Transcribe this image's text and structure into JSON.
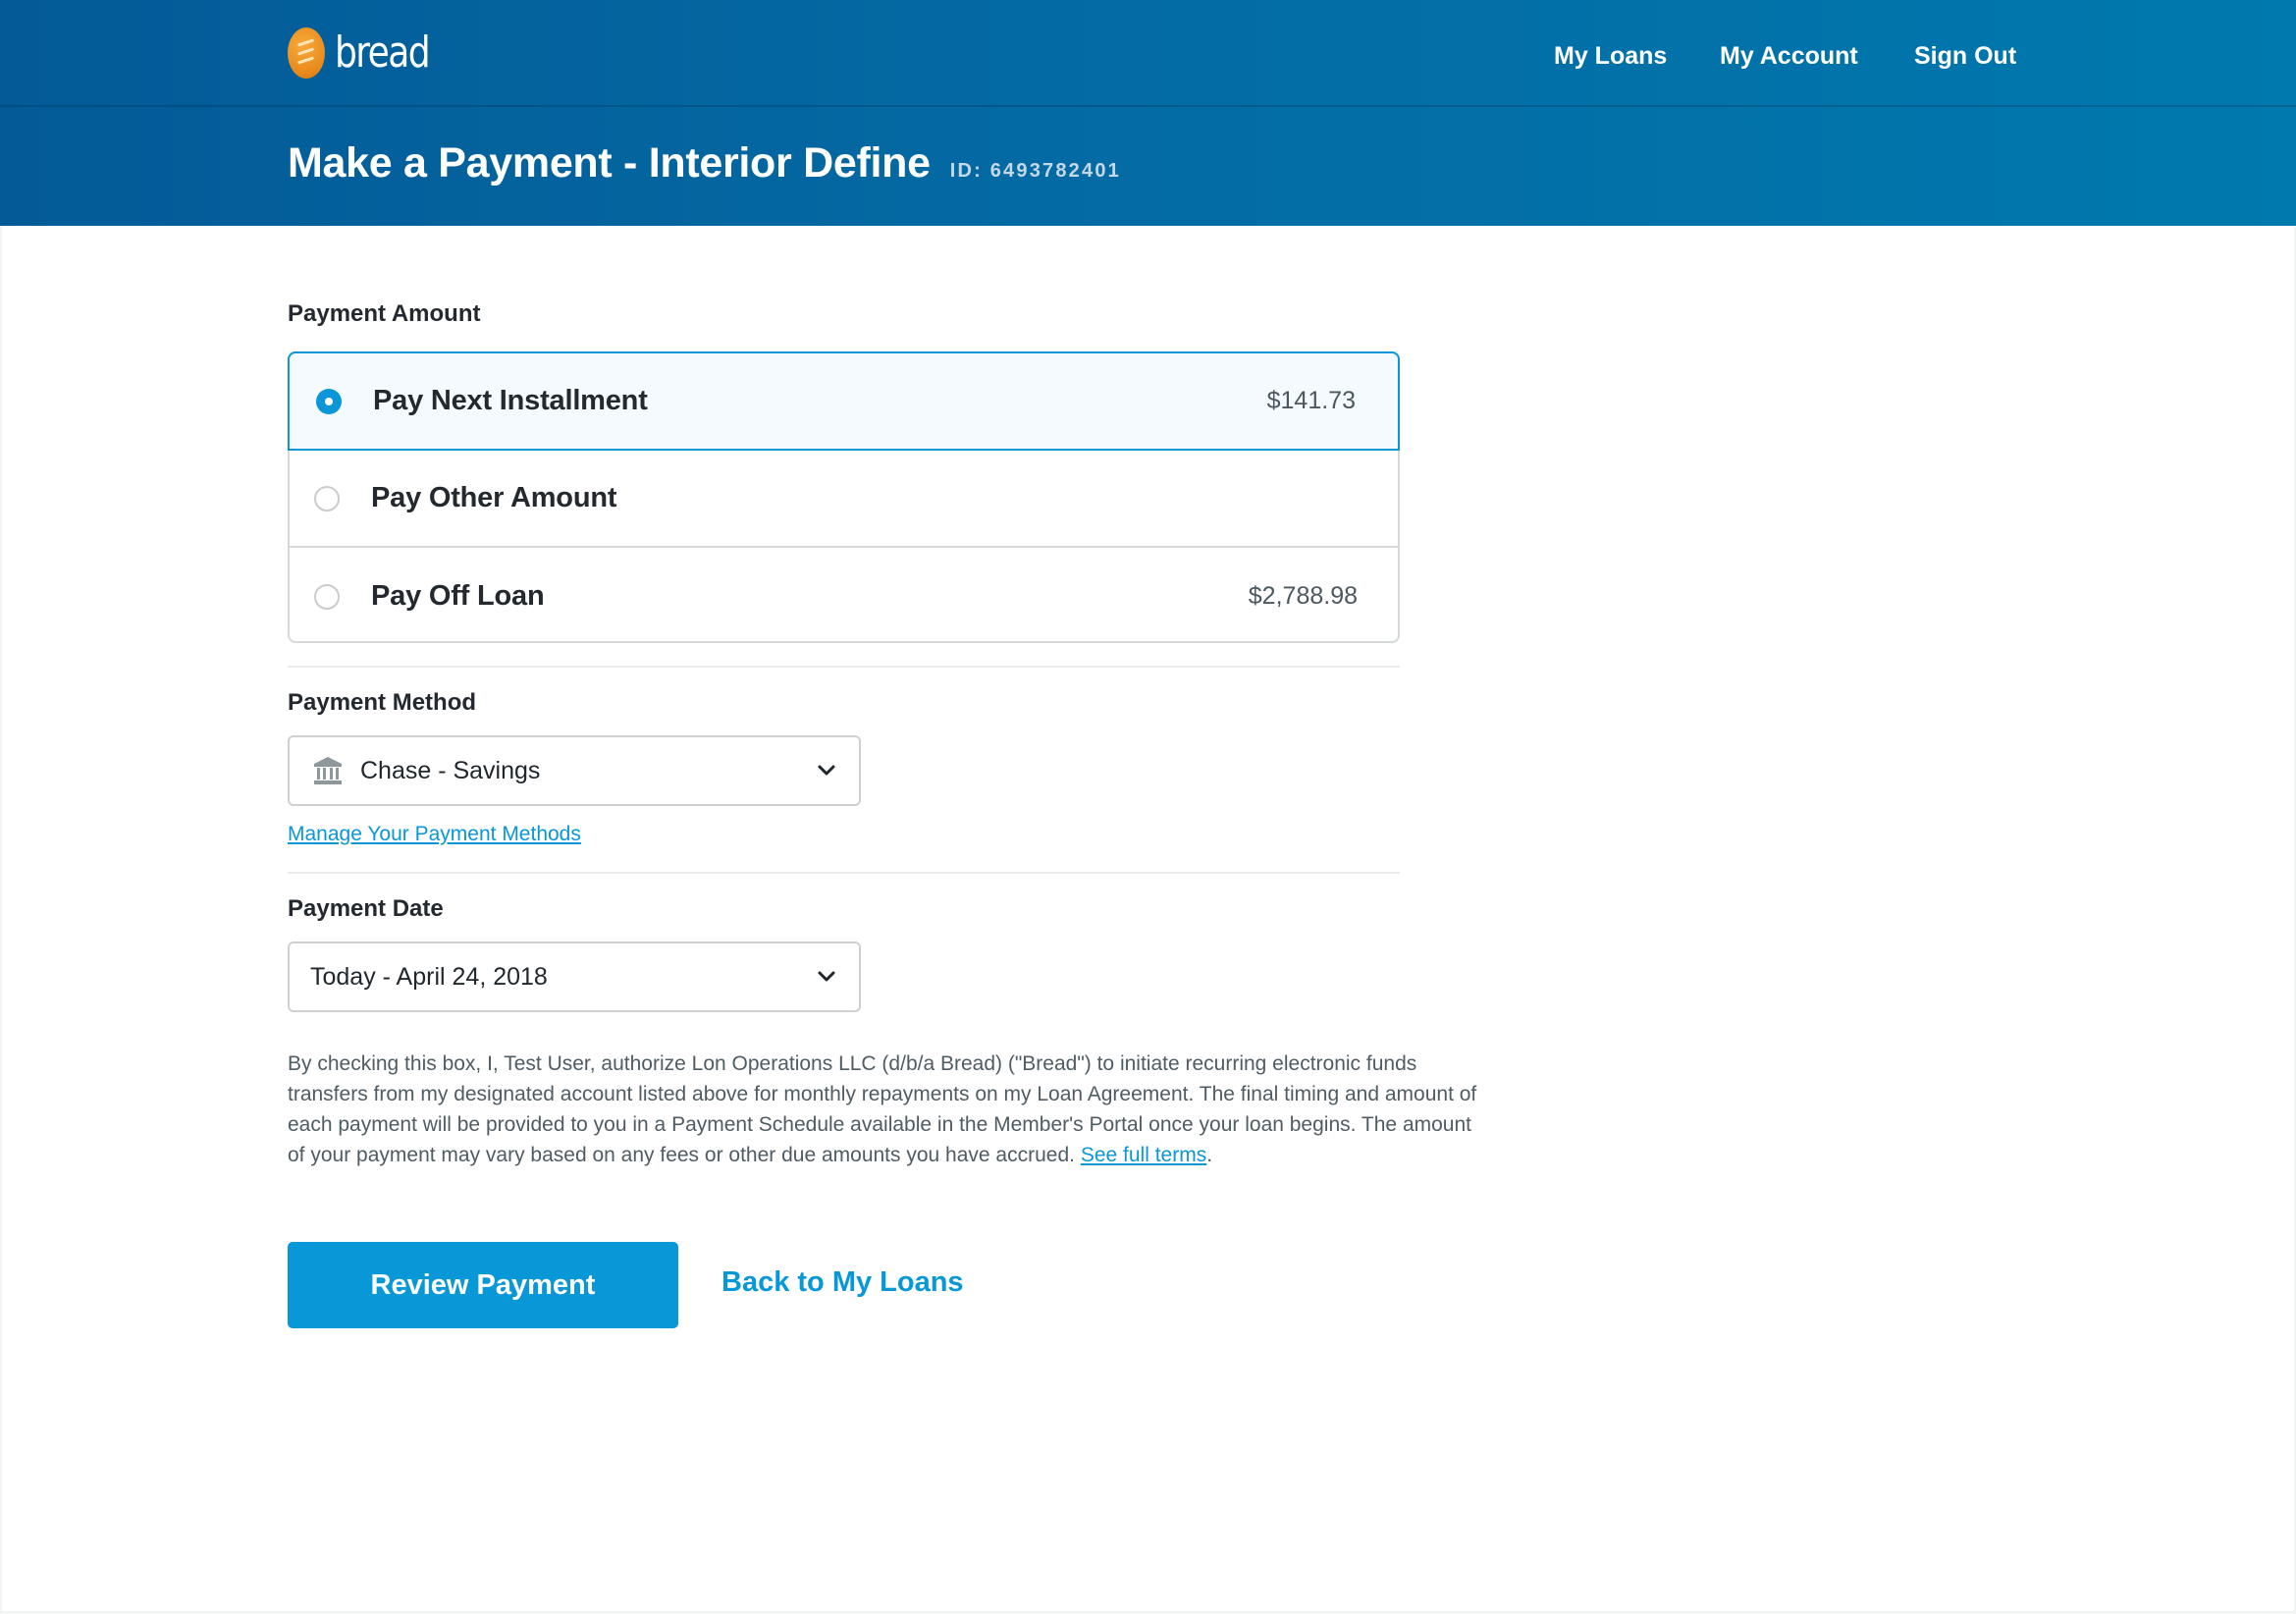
{
  "header": {
    "brand": "bread",
    "nav": [
      {
        "label": "My Loans"
      },
      {
        "label": "My Account"
      },
      {
        "label": "Sign Out"
      }
    ],
    "title": "Make a Payment - Interior Define",
    "id_label": "ID: 6493782401"
  },
  "payment_amount": {
    "label": "Payment Amount",
    "selected": "Pay Next Installment",
    "options": [
      {
        "label": "Pay Next Installment",
        "amount": "$141.73",
        "checked": true
      },
      {
        "label": "Pay Other Amount",
        "amount": "",
        "checked": false
      },
      {
        "label": "Pay Off Loan",
        "amount": "$2,788.98",
        "checked": false
      }
    ]
  },
  "payment_method": {
    "label": "Payment Method",
    "value": "Chase - Savings",
    "icon": "bank-icon",
    "manage_link": "Manage Your Payment Methods"
  },
  "payment_date": {
    "label": "Payment Date",
    "value": "Today - April 24, 2018"
  },
  "terms": {
    "text": "By checking this box, I, Test User, authorize Lon Operations LLC (d/b/a Bread) (\"Bread\") to initiate recurring electronic funds transfers from my designated account listed above for monthly repayments on my Loan Agreement. The final timing and amount of each payment will be provided to you in a Payment Schedule available in the Member's Portal once your loan begins. The amount of your payment may vary based on any fees or other due amounts you have accrued.",
    "link_label": "See full terms",
    "trailing": "."
  },
  "actions": {
    "primary": "Review Payment",
    "secondary": "Back to My Loans"
  },
  "colors": {
    "accent": "#0898d7",
    "header_start": "#035a97",
    "header_end": "#0079ae",
    "logo": "#e8891b"
  }
}
